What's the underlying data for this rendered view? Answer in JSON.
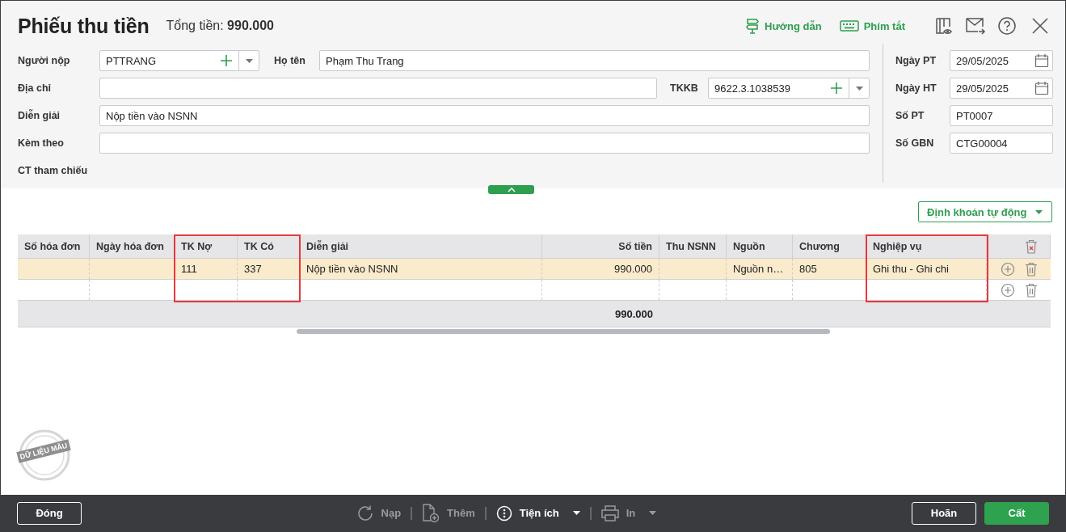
{
  "window": {
    "title": "Phiếu thu tiền",
    "total_label": "Tổng tiền:",
    "total_value": "990.000"
  },
  "header_links": [
    {
      "label": "Hướng dẫn",
      "kind": "guide"
    },
    {
      "label": "Phím tắt",
      "kind": "keyboard"
    }
  ],
  "form": {
    "rows": [
      [
        {
          "label": "Người nộp",
          "kind": "combo",
          "value": "PTTRANG"
        },
        {
          "label": "Họ tên",
          "kind": "text",
          "value": "Phạm Thu Trang"
        }
      ],
      [
        {
          "label": "Địa chỉ",
          "kind": "text"
        },
        {
          "label": "TKKB",
          "kind": "combo",
          "value": "9622.3.1038539"
        }
      ],
      [
        {
          "label": "Diễn giải",
          "kind": "text",
          "value": "Nộp tiền vào NSNN"
        }
      ],
      [
        {
          "label": "Kèm theo",
          "kind": "text"
        }
      ],
      [
        {
          "label": "CT tham chiếu",
          "kind": "label"
        }
      ]
    ],
    "side": [
      {
        "label": "Ngày PT",
        "kind": "date",
        "value": "29/05/2025"
      },
      {
        "label": "Ngày HT",
        "kind": "date",
        "value": "29/05/2025"
      },
      {
        "label": "Số PT",
        "kind": "text",
        "value": "PT0007"
      },
      {
        "label": "Số GBN",
        "kind": "text",
        "value": "CTG00004"
      }
    ]
  },
  "auto_button": "Định khoản tự động",
  "table": {
    "columns": [
      {
        "label": "Số hóa đơn",
        "highlighted": false
      },
      {
        "label": "Ngày hóa đơn",
        "highlighted": false
      },
      {
        "label": "TK Nợ",
        "highlighted": true
      },
      {
        "label": "TK Có",
        "highlighted": true
      },
      {
        "label": "Diễn giải",
        "highlighted": false
      },
      {
        "label": "Số tiền",
        "highlighted": false
      },
      {
        "label": "Thu NSNN",
        "highlighted": false
      },
      {
        "label": "Nguồn",
        "highlighted": false
      },
      {
        "label": "Chương",
        "highlighted": false
      },
      {
        "label": "Nghiệp vụ",
        "highlighted": true
      }
    ],
    "rows": [
      {
        "selected": true,
        "tk_no": "111",
        "tk_co": "337",
        "dien_giai": "Nộp tiền vào NSNN",
        "so_tien": "990.000",
        "nguon": "Nguồn n…",
        "chuong": "805",
        "nghiep_vu": "Ghi thu - Ghi chi"
      },
      {
        "selected": false
      }
    ],
    "totals": {
      "so_tien": "990.000"
    }
  },
  "stamp": "DỮ LIỆU MẪU",
  "footer": {
    "left": [
      {
        "label": "Đóng",
        "kind": "outline"
      }
    ],
    "tools": [
      {
        "label": "Nạp",
        "kind": "refresh",
        "disabled": true,
        "caret": false
      },
      {
        "label": "Thêm",
        "kind": "add",
        "disabled": true,
        "caret": false
      },
      {
        "label": "Tiện ích",
        "kind": "more",
        "disabled": false,
        "caret": true
      },
      {
        "label": "In",
        "kind": "print",
        "disabled": true,
        "caret": true
      }
    ],
    "right": [
      {
        "label": "Hoãn",
        "kind": "outline"
      },
      {
        "label": "Cất",
        "kind": "primary"
      }
    ]
  }
}
